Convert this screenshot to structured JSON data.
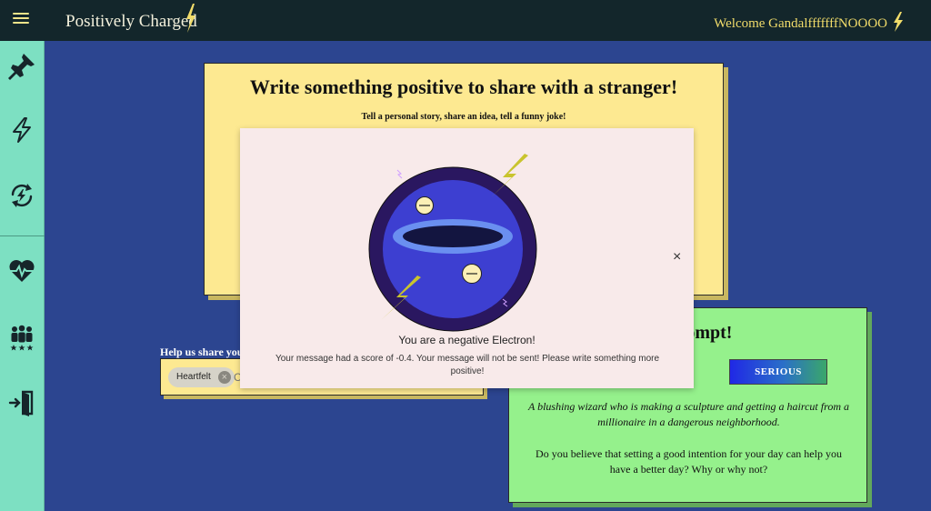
{
  "topbar": {
    "brand": "Positively Charged",
    "welcome": "Welcome GandalfffffffNOOOO"
  },
  "sidebar": {
    "items": [
      {
        "icon": "pin-icon"
      },
      {
        "icon": "lightning-icon"
      },
      {
        "icon": "recharge-icon"
      },
      {
        "icon": "heart-pulse-icon"
      },
      {
        "icon": "community-icon"
      },
      {
        "icon": "logout-icon"
      }
    ]
  },
  "write_card": {
    "title": "Write something positive to share with a stranger!",
    "subtitle": "Tell a personal story, share an idea, tell a funny joke!"
  },
  "tags": {
    "label": "Help us share you",
    "chip": "Heartfelt",
    "placeholder": "C"
  },
  "prompt_card": {
    "title": "ily Prompt!",
    "button": "SERIOUS",
    "prompt": "A blushing wizard who is making a sculpture and getting a haircut from a millionaire in a dangerous neighborhood.",
    "question": "Do you believe that setting a good intention for your day can help you have a better day? Why or why not?"
  },
  "modal": {
    "title": "You are a negative Electron!",
    "message": "Your message had a score of -0.4. Your message will not be sent! Please write something more positive!",
    "close": "×"
  },
  "colors": {
    "background": "#2c4590",
    "topbar": "#13262b",
    "sidebar": "#7de0c2",
    "yellow_card": "#fde991",
    "green_card": "#95f18c",
    "modal": "#f8eaea",
    "accent_bolt": "#c9c42e"
  }
}
